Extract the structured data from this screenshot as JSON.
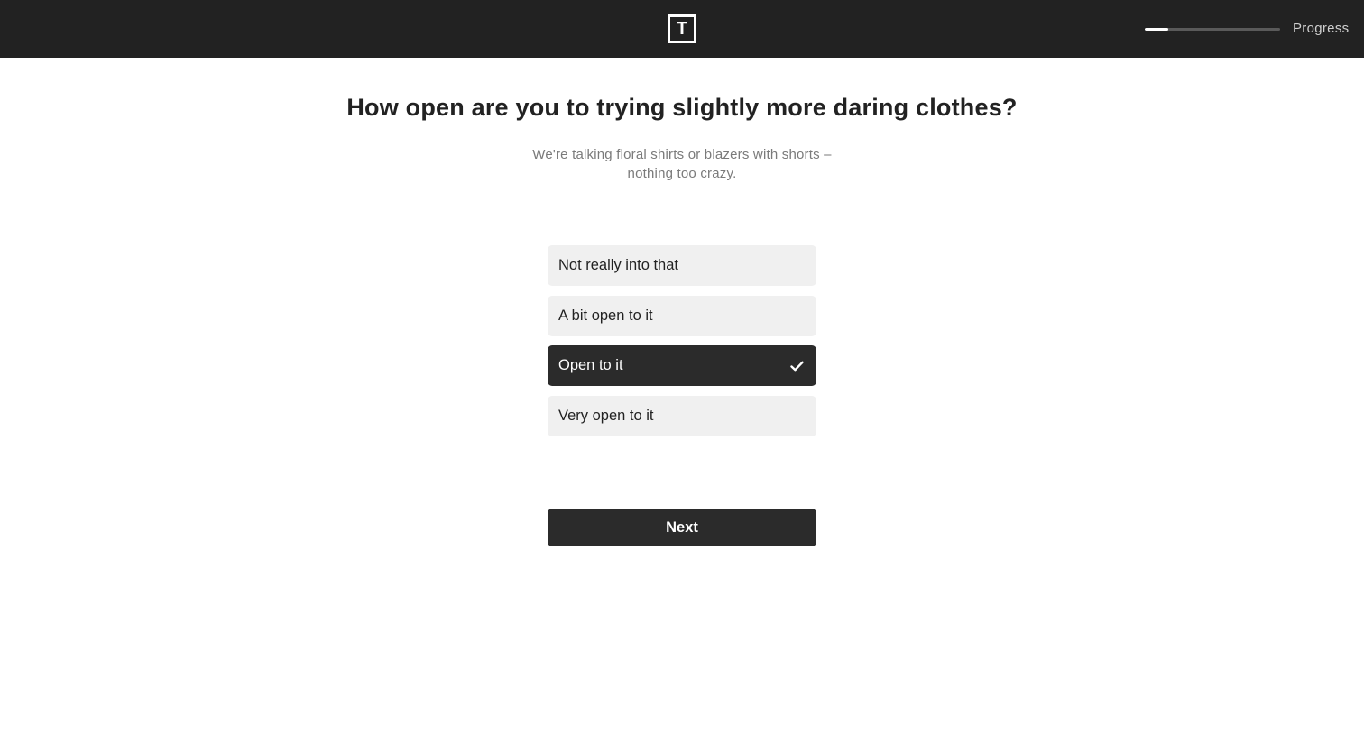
{
  "header": {
    "logo_letter": "T",
    "progress_label": "Progress",
    "progress_fraction": 0.17
  },
  "question": {
    "title": "How open are you to trying slightly more daring clothes?",
    "subtitle_line1": "We're talking floral shirts or blazers with shorts –",
    "subtitle_line2": "nothing too crazy."
  },
  "options": [
    {
      "label": "Not really into that",
      "selected": false
    },
    {
      "label": "A bit open to it",
      "selected": false
    },
    {
      "label": "Open to it",
      "selected": true
    },
    {
      "label": "Very open to it",
      "selected": false
    }
  ],
  "actions": {
    "next_label": "Next"
  },
  "colors": {
    "topbar": "#222222",
    "selected_option": "#2b2b2b",
    "option": "#f0f0f0"
  },
  "icons": {
    "logo": "t-logo-icon",
    "selected": "check-icon"
  }
}
